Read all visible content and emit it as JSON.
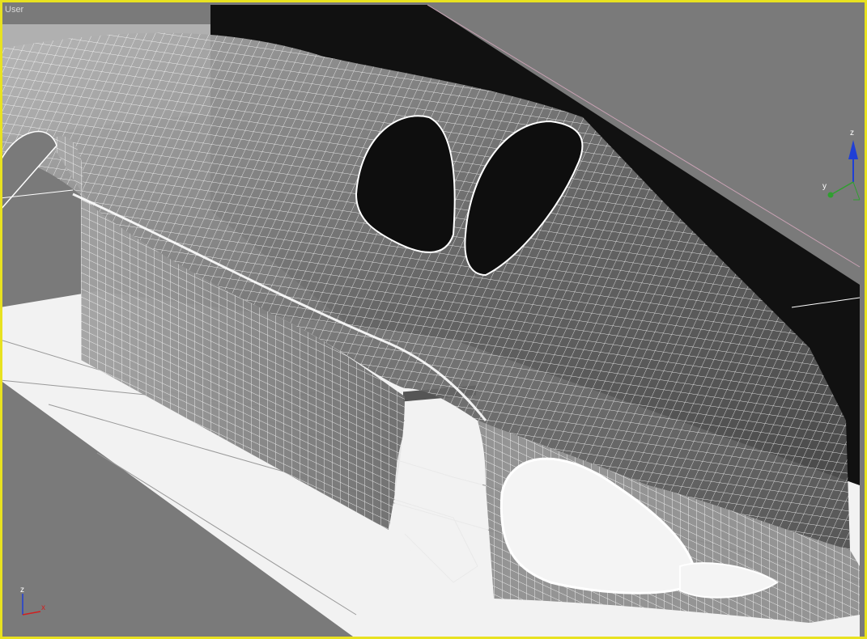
{
  "viewport": {
    "label": "User",
    "active_border_color": "#e8e220",
    "background_color": "#7a7a7a"
  },
  "view_cube_gizmo": {
    "axes": [
      "z",
      "y"
    ],
    "colors": {
      "z": "#1f3fd6",
      "y": "#2f9f2f"
    }
  },
  "world_axis_gizmo": {
    "axes": [
      "z",
      "x"
    ],
    "colors": {
      "z": "#1f3fd6",
      "x": "#d02020"
    }
  },
  "scene": {
    "object": "car-body-mesh",
    "wire_color": "#ffffff",
    "dark_plane_color": "#111111",
    "ground_plane_color": "#f2f2f2"
  }
}
